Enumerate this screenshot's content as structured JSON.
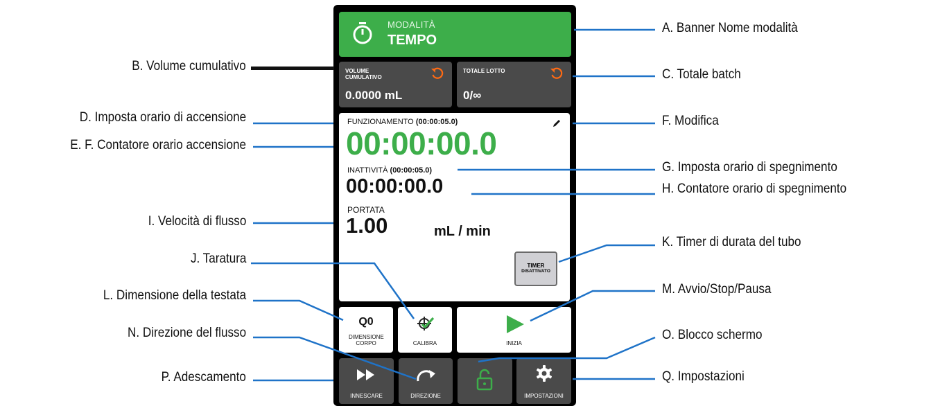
{
  "banner": {
    "mode_label": "MODALITÀ",
    "mode_name": "TEMPO",
    "icon": "stopwatch-icon"
  },
  "tiles": {
    "cumulative": {
      "label": "VOLUME CUMULATIVO",
      "value": "0.0000 mL",
      "icon": "reset-icon"
    },
    "batch": {
      "label": "TOTALE LOTTO",
      "value": "0/∞",
      "icon": "reset-icon"
    }
  },
  "panel": {
    "run_label": "FUNZIONAMENTO",
    "run_setting": "(00:00:05.0)",
    "run_counter": "00:00:00.0",
    "idle_label": "INATTIVITÀ",
    "idle_setting": "(00:00:05.0)",
    "idle_counter": "00:00:00.0",
    "rate_label": "PORTATA",
    "rate_value": "1.00",
    "rate_unit": "mL / min",
    "tube_timer_line1": "TIMER",
    "tube_timer_line2": "DISATTIVATO"
  },
  "buttons": {
    "head_size_value": "Q0",
    "head_size_label": "DIMENSIONE CORPO",
    "calibrate": "CALIBRA",
    "start": "INIZIA",
    "prime": "INNESCARE",
    "direction": "DIREZIONE",
    "settings": "IMPOSTAZIONI"
  },
  "callouts": {
    "A": "A. Banner Nome modalità",
    "B": "B. Volume cumulativo",
    "C": "C. Totale batch",
    "D": "D. Imposta orario di accensione",
    "E": "E. F. Contatore orario accensione",
    "F": "F. Modifica",
    "G": "G. Imposta orario di spegnimento",
    "H": "H. Contatore orario di spegnimento",
    "I": "I. Velocità di flusso",
    "J": "J. Taratura",
    "K": "K. Timer di durata del tubo",
    "L": "L. Dimensione della testata",
    "M": "M. Avvio/Stop/Pausa",
    "N": "N. Direzione del flusso",
    "O": "O. Blocco schermo",
    "P": "P. Adescamento",
    "Q": "Q. Impostazioni"
  },
  "colors": {
    "accent_green": "#3dae4a",
    "callout_line": "#1f73c8",
    "tile_dark": "#4a4a4a"
  }
}
